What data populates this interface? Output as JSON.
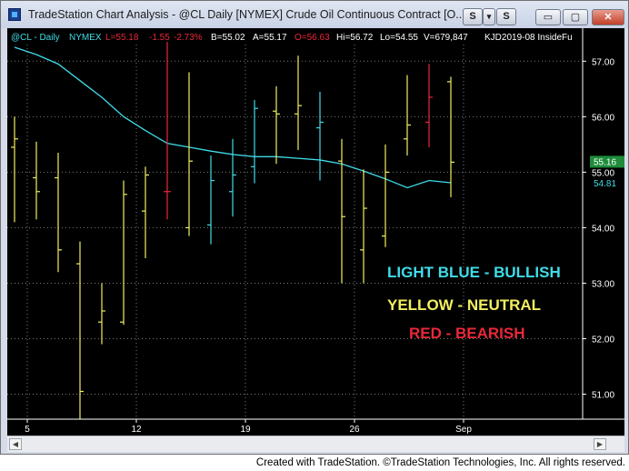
{
  "window": {
    "title": "TradeStation Chart Analysis - @CL Daily [NYMEX] Crude Oil Continuous Contract [O...",
    "s_button": "S",
    "s_dropdown": "▾",
    "minimize": "▭",
    "maximize": "▢",
    "close": "✕"
  },
  "footer": {
    "credit": "Created with TradeStation. ©TradeStation Technologies, Inc. All rights reserved."
  },
  "colors": {
    "bullish": "#3fdce8",
    "neutral": "#f2ee5e",
    "bearish": "#e8283a",
    "ma": "#3fdce8",
    "background": "#000000",
    "grid": "#7a7a7a"
  },
  "chart_data": {
    "type": "ohlc",
    "symbol": "@CL - Daily",
    "exchange": "NYMEX",
    "header": {
      "last": "L=55.18",
      "change": "-1.55",
      "change_pct": "-2.73%",
      "bid": "B=55.02",
      "ask": "A=55.17",
      "open": "O=56.63",
      "high": "Hi=56.72",
      "low": "Lo=54.55",
      "volume": "V=679,847",
      "indicator": "KJD2019-08 InsideFu"
    },
    "ylim": [
      50.55,
      57.3
    ],
    "yticks": [
      "57.00",
      "56.00",
      "55.00",
      "54.00",
      "53.00",
      "52.00",
      "51.00"
    ],
    "ytick_values": [
      57,
      56,
      55,
      54,
      53,
      52,
      51
    ],
    "xticks": [
      "5",
      "12",
      "19",
      "26",
      "Sep"
    ],
    "xtick_bars": [
      1,
      6,
      11,
      16,
      21
    ],
    "price_label_close": "55.16",
    "price_label_ma": "54.81",
    "bars": [
      {
        "o": 55.45,
        "h": 56.0,
        "l": 54.1,
        "c": 55.6,
        "s": "neutral"
      },
      {
        "o": 54.9,
        "h": 55.55,
        "l": 54.15,
        "c": 54.65,
        "s": "neutral"
      },
      {
        "o": 54.9,
        "h": 55.35,
        "l": 53.2,
        "c": 53.6,
        "s": "neutral"
      },
      {
        "o": 53.35,
        "h": 53.75,
        "l": 50.55,
        "c": 51.05,
        "s": "neutral"
      },
      {
        "o": 52.3,
        "h": 53.0,
        "l": 51.9,
        "c": 52.5,
        "s": "neutral"
      },
      {
        "o": 52.3,
        "h": 54.85,
        "l": 52.25,
        "c": 54.6,
        "s": "neutral"
      },
      {
        "o": 54.3,
        "h": 55.1,
        "l": 53.45,
        "c": 54.95,
        "s": "neutral"
      },
      {
        "o": 54.65,
        "h": 57.35,
        "l": 54.15,
        "c": 54.65,
        "s": "bearish"
      },
      {
        "o": 54.0,
        "h": 56.8,
        "l": 53.85,
        "c": 55.2,
        "s": "neutral"
      },
      {
        "o": 54.05,
        "h": 55.3,
        "l": 53.7,
        "c": 54.85,
        "s": "bullish"
      },
      {
        "o": 54.65,
        "h": 55.6,
        "l": 54.2,
        "c": 54.95,
        "s": "bullish"
      },
      {
        "o": 55.1,
        "h": 56.3,
        "l": 54.8,
        "c": 56.15,
        "s": "bullish"
      },
      {
        "o": 56.1,
        "h": 56.55,
        "l": 55.15,
        "c": 56.05,
        "s": "neutral"
      },
      {
        "o": 56.05,
        "h": 57.1,
        "l": 55.4,
        "c": 56.2,
        "s": "neutral"
      },
      {
        "o": 55.8,
        "h": 56.45,
        "l": 54.85,
        "c": 55.9,
        "s": "bullish"
      },
      {
        "o": 55.2,
        "h": 55.6,
        "l": 53.0,
        "c": 54.2,
        "s": "neutral"
      },
      {
        "o": 53.6,
        "h": 55.05,
        "l": 53.0,
        "c": 54.35,
        "s": "neutral"
      },
      {
        "o": 53.85,
        "h": 55.5,
        "l": 53.65,
        "c": 55.0,
        "s": "neutral"
      },
      {
        "o": 55.6,
        "h": 56.75,
        "l": 55.3,
        "c": 55.85,
        "s": "neutral"
      },
      {
        "o": 55.9,
        "h": 56.95,
        "l": 55.45,
        "c": 56.35,
        "s": "bearish"
      },
      {
        "o": 56.63,
        "h": 56.72,
        "l": 54.55,
        "c": 55.18,
        "s": "neutral"
      }
    ],
    "ma_line": [
      57.25,
      57.12,
      56.95,
      56.65,
      56.35,
      56.0,
      55.75,
      55.52,
      55.45,
      55.38,
      55.32,
      55.28,
      55.28,
      55.25,
      55.22,
      55.15,
      55.02,
      54.88,
      54.72,
      54.85,
      54.81
    ],
    "legend": [
      {
        "label": "LIGHT BLUE - BULLISH",
        "color": "#3fdce8"
      },
      {
        "label": "YELLOW -  NEUTRAL",
        "color": "#f2ee5e"
      },
      {
        "label": "RED - BEARISH",
        "color": "#e8283a"
      }
    ]
  }
}
